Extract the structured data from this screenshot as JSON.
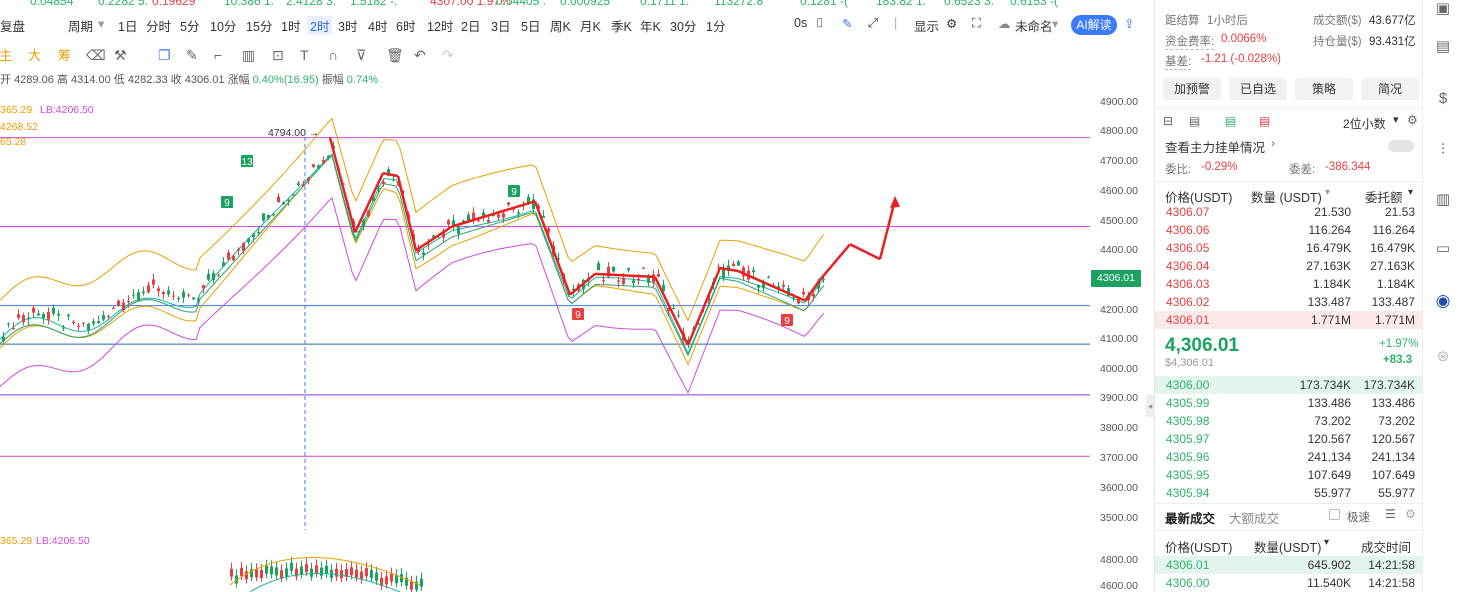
{
  "ticker": [
    {
      "text": "0.04854",
      "cls": "green"
    },
    {
      "text": "0.2282 5.",
      "cls": "green"
    },
    {
      "text": "0.19629",
      "cls": "red"
    },
    {
      "text": "10.386 1.",
      "cls": "green"
    },
    {
      "text": "2.4128 3.",
      "cls": "green"
    },
    {
      "text": "1.5182 -.",
      "cls": "green"
    },
    {
      "text": "4307.00 1.97%",
      "cls": "red"
    },
    {
      "text": "0.04405 .",
      "cls": "green"
    },
    {
      "text": "0.000925",
      "cls": "green"
    },
    {
      "text": "0.1711 1.",
      "cls": "green"
    },
    {
      "text": "113272.8",
      "cls": "green"
    },
    {
      "text": "0.1281 -(",
      "cls": "green"
    },
    {
      "text": "183.82 1.",
      "cls": "green"
    },
    {
      "text": "0.6523 3.",
      "cls": "green"
    },
    {
      "text": "0.6153 -(",
      "cls": "green"
    }
  ],
  "toolbar": {
    "chart_type": "复盘",
    "period": "周期",
    "items": [
      "1日",
      "分时",
      "5分",
      "10分",
      "15分",
      "1时",
      "2时",
      "3时",
      "4时",
      "6时",
      "12时",
      "2日",
      "3日",
      "5日",
      "周K",
      "月K",
      "季K",
      "年K",
      "30分",
      "1分"
    ],
    "active": "2时",
    "zero_s": "0s",
    "display": "显示",
    "unnamed": "未命名",
    "ai": "AI解读"
  },
  "drawbar": {
    "labels": [
      "主",
      "大",
      "筹"
    ]
  },
  "ohlc": {
    "open_label": "开",
    "open": "4289.06",
    "high_label": "高",
    "high": "4314.00",
    "low_label": "低",
    "low": "4282.33",
    "close_label": "收",
    "close": "4306.01",
    "chg_label": "涨幅",
    "chg": "0.40%(16.95)",
    "amp_label": "振幅",
    "amp": "0.74%"
  },
  "indicators": {
    "l1a": "365.29",
    "l1b": "LB:4206.50",
    "l2": "4268.52",
    "l3": "65.28",
    "sub_a": "365.29",
    "sub_b": "LB:4206.50"
  },
  "price_axis": [
    "4900.00",
    "4800.00",
    "4700.00",
    "4600.00",
    "4500.00",
    "4400.00",
    "4300.00",
    "4200.00",
    "4100.00",
    "4000.00",
    "3900.00",
    "3800.00",
    "3700.00",
    "3600.00",
    "3500.00"
  ],
  "sub_axis": [
    "4800.00",
    "4600.00"
  ],
  "current_price": "4306.01",
  "high_marker": "4794.00 →",
  "td": {
    "a": "13",
    "b": "9",
    "c": "9",
    "d": "9",
    "e": "9"
  },
  "panel": {
    "settle_label": "距结算",
    "settle": "1小时后",
    "turnover_label": "成交额($)",
    "turnover": "43.677亿",
    "funding_label": "资金费率:",
    "funding": "0.0066%",
    "oi_label": "持仓量($)",
    "oi": "93.431亿",
    "basis_label": "基差:",
    "basis": "-1.21 (-0.028%)",
    "buttons": [
      "加预警",
      "已自选",
      "策略",
      "简况"
    ],
    "decimals": "2位小数",
    "main_orders": "查看主力挂单情况",
    "ratio_label": "委比:",
    "ratio": "-0.29%",
    "diff_label": "委差:",
    "diff": "-386.344",
    "h_price": "价格(USDT)",
    "h_qty": "数量 (USDT)",
    "h_total": "委托额",
    "asks": [
      [
        "4306.07",
        "21.530",
        "21.53"
      ],
      [
        "4306.06",
        "116.264",
        "116.264"
      ],
      [
        "4306.05",
        "16.479K",
        "16.479K"
      ],
      [
        "4306.04",
        "27.163K",
        "27.163K"
      ],
      [
        "4306.03",
        "1.184K",
        "1.184K"
      ],
      [
        "4306.02",
        "133.487",
        "133.487"
      ],
      [
        "4306.01",
        "1.771M",
        "1.771M"
      ]
    ],
    "last": "4,306.01",
    "last_usd": "$4,306.01",
    "pct": "+1.97%",
    "chg": "+83.3",
    "bids": [
      [
        "4306.00",
        "173.734K",
        "173.734K"
      ],
      [
        "4305.99",
        "133.486",
        "133.486"
      ],
      [
        "4305.98",
        "73.202",
        "73.202"
      ],
      [
        "4305.97",
        "120.567",
        "120.567"
      ],
      [
        "4305.96",
        "241.134",
        "241.134"
      ],
      [
        "4305.95",
        "107.649",
        "107.649"
      ],
      [
        "4305.94",
        "55.977",
        "55.977"
      ]
    ],
    "tab_latest": "最新成交",
    "tab_large": "大额成交",
    "fast": "极速",
    "t_price": "价格(USDT)",
    "t_qty": "数量(USDT)",
    "t_time": "成交时间",
    "trades": [
      [
        "4306.01",
        "645.902",
        "14:21:58"
      ],
      [
        "4306.00",
        "11.540K",
        "14:21:58"
      ]
    ]
  },
  "chart_data": {
    "type": "candlestick",
    "interval": "2时",
    "y_range": [
      3500,
      4900
    ],
    "horizontal_lines": [
      4780,
      4480,
      4213,
      4083,
      3912,
      3705
    ],
    "ohlc_last": {
      "open": 4289.06,
      "high": 4314.0,
      "low": 4282.33,
      "close": 4306.01
    },
    "path_markers": [
      [
        330,
        4780
      ],
      [
        355,
        4460
      ],
      [
        383,
        4660
      ],
      [
        398,
        4650
      ],
      [
        416,
        4400
      ],
      [
        452,
        4480
      ],
      [
        535,
        4565
      ],
      [
        570,
        4250
      ],
      [
        595,
        4320
      ],
      [
        655,
        4310
      ],
      [
        688,
        4080
      ],
      [
        720,
        4340
      ],
      [
        738,
        4330
      ],
      [
        805,
        4230
      ],
      [
        820,
        4300
      ],
      [
        850,
        4420
      ],
      [
        880,
        4370
      ],
      [
        895,
        4570
      ]
    ]
  }
}
